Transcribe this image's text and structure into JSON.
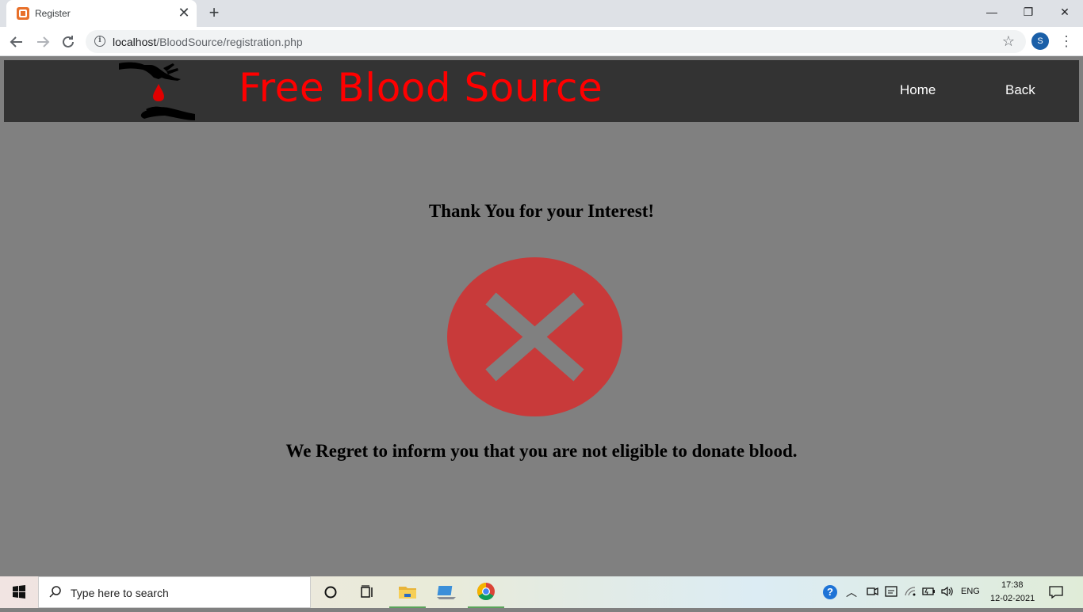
{
  "browser": {
    "tab_title": "Register",
    "tab_close": "✕",
    "new_tab": "+",
    "window_controls": {
      "minimize": "—",
      "restore": "❐",
      "close": "✕"
    },
    "url_host": "localhost",
    "url_path": "/BloodSource/registration.php",
    "profile_initial": "S"
  },
  "site": {
    "title": "Free Blood Source",
    "nav": {
      "home": "Home",
      "back": "Back"
    },
    "colors": {
      "header_bg": "#333333",
      "title": "#ff0000",
      "page_bg": "#808080",
      "fail_icon": "#c83a3a"
    }
  },
  "message": {
    "thank_you": "Thank You for your Interest!",
    "regret": "We Regret to inform you that you are not eligible to donate blood."
  },
  "taskbar": {
    "search_placeholder": "Type here to search",
    "language": "ENG",
    "time": "17:38",
    "date": "12-02-2021"
  }
}
